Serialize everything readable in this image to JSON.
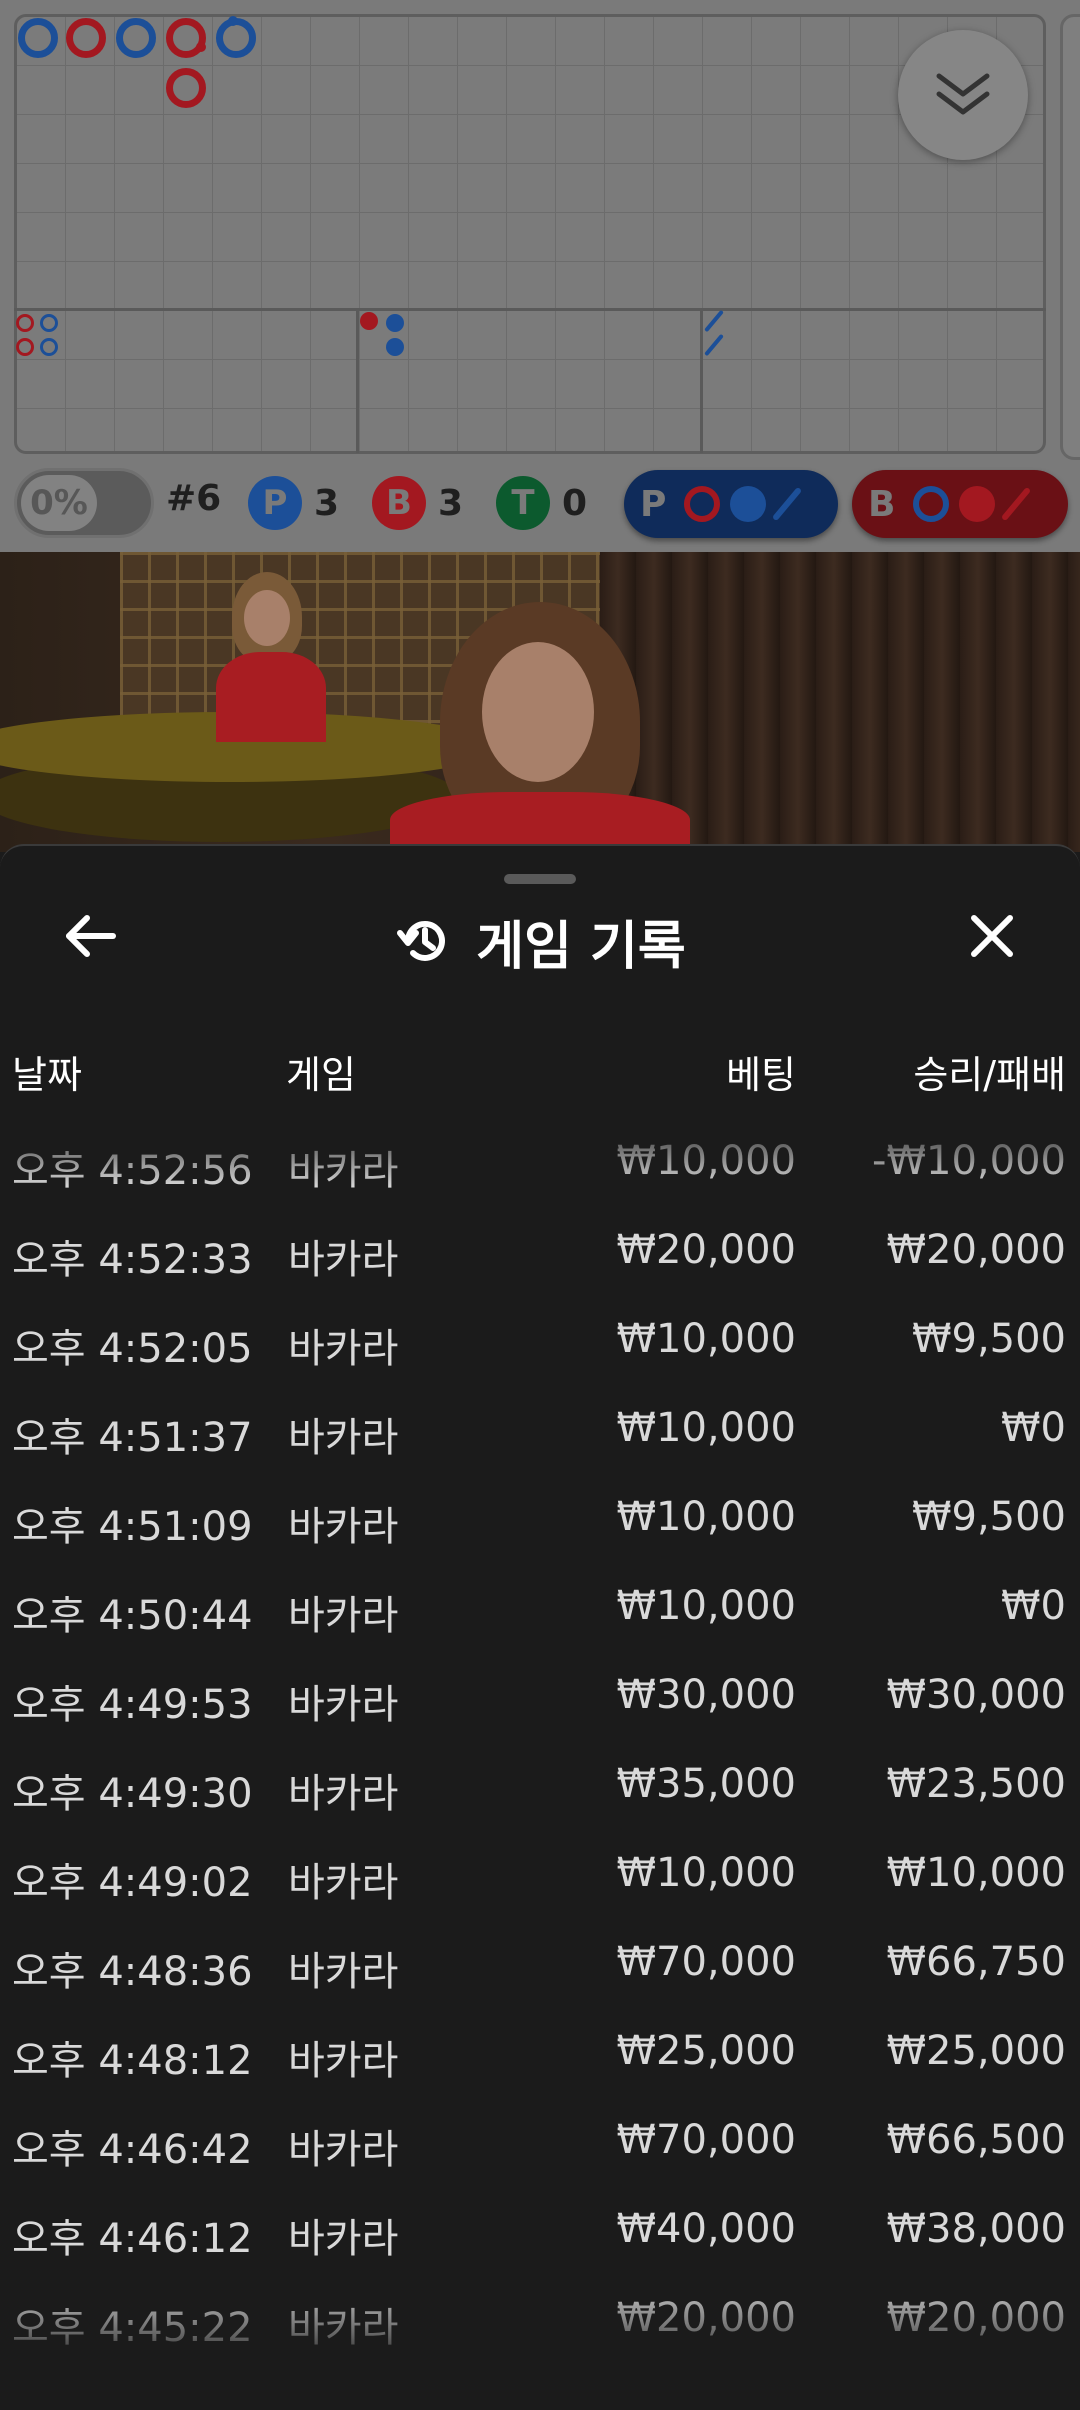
{
  "colors": {
    "player": "#1c4f98",
    "banker": "#a31820",
    "tie": "#0c5a2e",
    "sheet_bg": "#1b1b1b"
  },
  "roadmap": {
    "percent_toggle": "0%",
    "shoe_number": "#6",
    "stats": {
      "player": {
        "letter": "P",
        "count": "3"
      },
      "banker": {
        "letter": "B",
        "count": "3"
      },
      "tie": {
        "letter": "T",
        "count": "0"
      }
    },
    "predict_player": {
      "letter": "P"
    },
    "predict_banker": {
      "letter": "B"
    },
    "collapse_icon": "chevron-double-down-icon"
  },
  "history": {
    "title": "게임 기록",
    "title_icon": "history-icon",
    "back_icon": "arrow-left-icon",
    "close_icon": "close-icon",
    "columns": {
      "date": "날짜",
      "game": "게임",
      "bet": "베팅",
      "winloss": "승리/패배"
    },
    "rows": [
      {
        "time": "오후 4:52:56",
        "game": "바카라",
        "bet": "₩10,000",
        "winloss": "-₩10,000"
      },
      {
        "time": "오후 4:52:33",
        "game": "바카라",
        "bet": "₩20,000",
        "winloss": "₩20,000"
      },
      {
        "time": "오후 4:52:05",
        "game": "바카라",
        "bet": "₩10,000",
        "winloss": "₩9,500"
      },
      {
        "time": "오후 4:51:37",
        "game": "바카라",
        "bet": "₩10,000",
        "winloss": "₩0"
      },
      {
        "time": "오후 4:51:09",
        "game": "바카라",
        "bet": "₩10,000",
        "winloss": "₩9,500"
      },
      {
        "time": "오후 4:50:44",
        "game": "바카라",
        "bet": "₩10,000",
        "winloss": "₩0"
      },
      {
        "time": "오후 4:49:53",
        "game": "바카라",
        "bet": "₩30,000",
        "winloss": "₩30,000"
      },
      {
        "time": "오후 4:49:30",
        "game": "바카라",
        "bet": "₩35,000",
        "winloss": "₩23,500"
      },
      {
        "time": "오후 4:49:02",
        "game": "바카라",
        "bet": "₩10,000",
        "winloss": "₩10,000"
      },
      {
        "time": "오후 4:48:36",
        "game": "바카라",
        "bet": "₩70,000",
        "winloss": "₩66,750"
      },
      {
        "time": "오후 4:48:12",
        "game": "바카라",
        "bet": "₩25,000",
        "winloss": "₩25,000"
      },
      {
        "time": "오후 4:46:42",
        "game": "바카라",
        "bet": "₩70,000",
        "winloss": "₩66,500"
      },
      {
        "time": "오후 4:46:12",
        "game": "바카라",
        "bet": "₩40,000",
        "winloss": "₩38,000"
      },
      {
        "time": "오후 4:45:22",
        "game": "바카라",
        "bet": "₩20,000",
        "winloss": "₩20,000"
      }
    ]
  }
}
